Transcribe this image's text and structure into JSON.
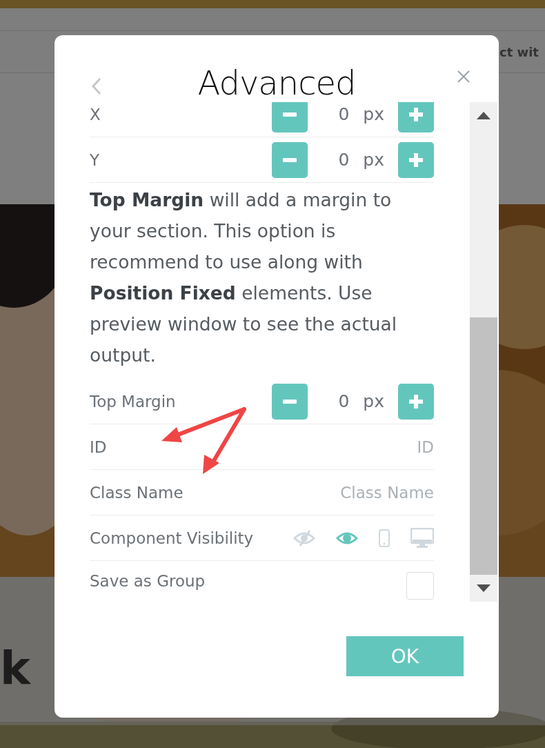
{
  "page": {
    "nav_text": "ct wit",
    "hero_text": "k"
  },
  "dialog": {
    "title": "Advanced",
    "rows": [
      {
        "kind": "stepper",
        "label": "X",
        "value": "0",
        "unit": "px"
      },
      {
        "kind": "stepper",
        "label": "Y",
        "value": "0",
        "unit": "px"
      },
      {
        "kind": "text",
        "text": "**Top Margin** will add a margin to your section. This option is recommend to use along with **Position Fixed** elements. Use preview window to see the actual output."
      },
      {
        "kind": "stepper",
        "label": "Top Margin",
        "value": "0",
        "unit": "px"
      },
      {
        "kind": "input",
        "label": "ID",
        "placeholder": "ID"
      },
      {
        "kind": "input",
        "label": "Class Name",
        "placeholder": "Class Name"
      },
      {
        "kind": "visibility",
        "label": "Component Visibility",
        "options": [
          {
            "kind": "hidden",
            "selected": false
          },
          {
            "kind": "visible",
            "selected": true
          },
          {
            "kind": "mobile",
            "selected": false
          },
          {
            "kind": "desktop",
            "selected": false
          }
        ]
      },
      {
        "kind": "checkbox",
        "label": "Save as Group",
        "checked": false
      }
    ],
    "ok_button": "OK"
  }
}
